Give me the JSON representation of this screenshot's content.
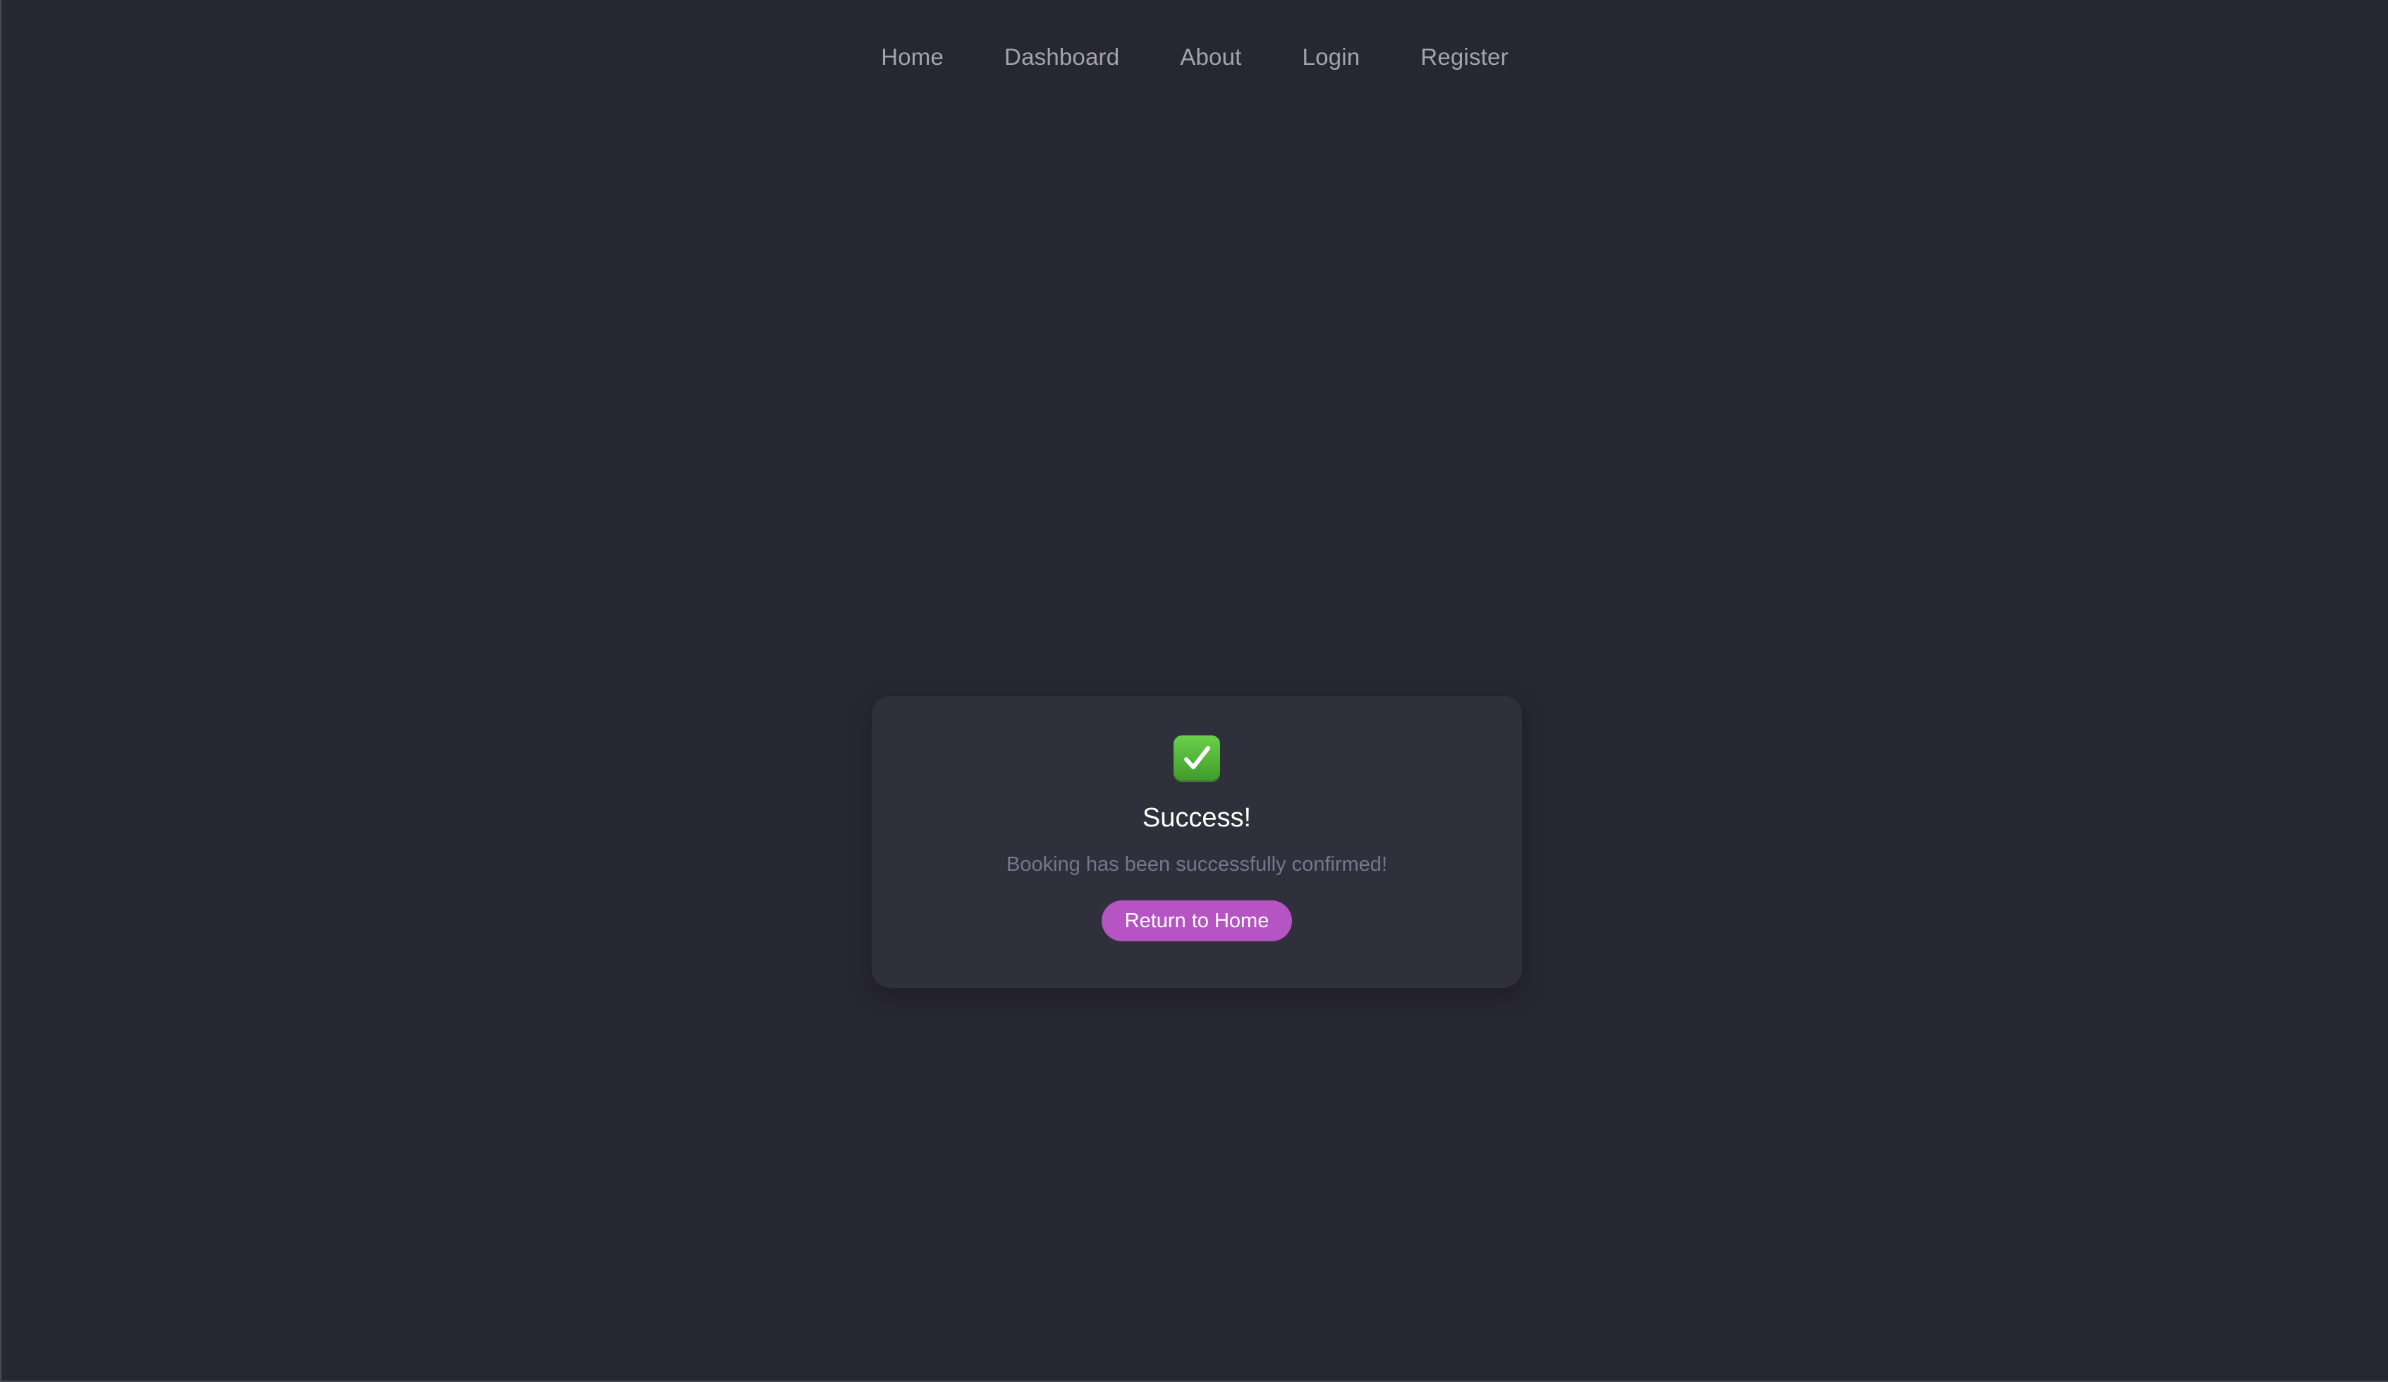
{
  "nav": {
    "items": [
      {
        "label": "Home"
      },
      {
        "label": "Dashboard"
      },
      {
        "label": "About"
      },
      {
        "label": "Login"
      },
      {
        "label": "Register"
      }
    ]
  },
  "card": {
    "icon": "check-mark-button-icon",
    "title": "Success!",
    "message": "Booking has been successfully confirmed!",
    "button_label": "Return to Home"
  },
  "colors": {
    "background": "#272633",
    "card": "#302f3c",
    "accent": "#b654c4",
    "success": "#4caf3a"
  }
}
